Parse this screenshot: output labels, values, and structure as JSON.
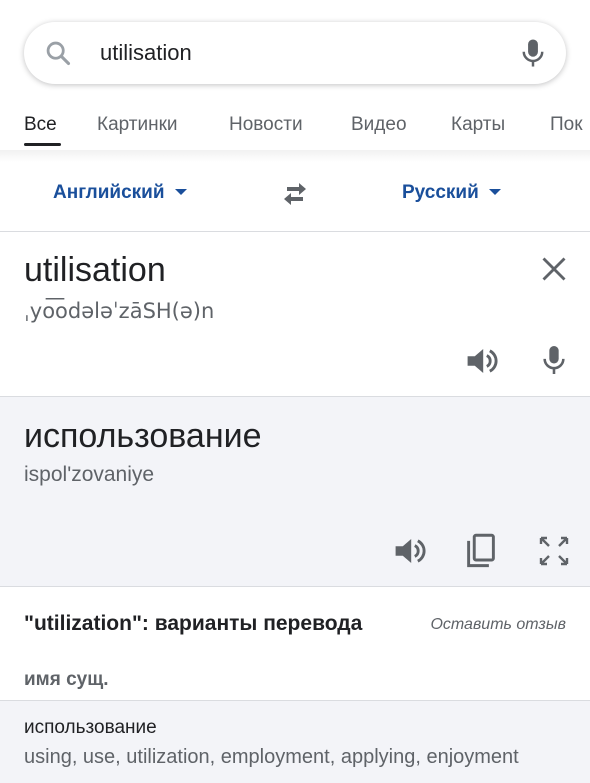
{
  "search": {
    "query": "utilisation"
  },
  "tabs": [
    {
      "label": "Все"
    },
    {
      "label": "Картинки"
    },
    {
      "label": "Новости"
    },
    {
      "label": "Видео"
    },
    {
      "label": "Карты"
    },
    {
      "label": "Пок"
    }
  ],
  "languages": {
    "source": "Английский",
    "target": "Русский"
  },
  "source": {
    "word": "utilisation",
    "transcription": "ˌyo͞odələˈzāSH(ə)n"
  },
  "target": {
    "word": "использование",
    "transliteration": "ispol'zovaniye"
  },
  "variants": {
    "title": "\"utilization\": варианты перевода",
    "feedback": "Оставить отзыв",
    "part_of_speech": "имя сущ.",
    "items": [
      {
        "word": "использование",
        "synonyms": "using, use, utilization, employment, applying, enjoyment"
      }
    ]
  },
  "colors": {
    "accent": "#1a4f9b",
    "panel": "#f3f4f8",
    "icon": "#5f6368"
  }
}
